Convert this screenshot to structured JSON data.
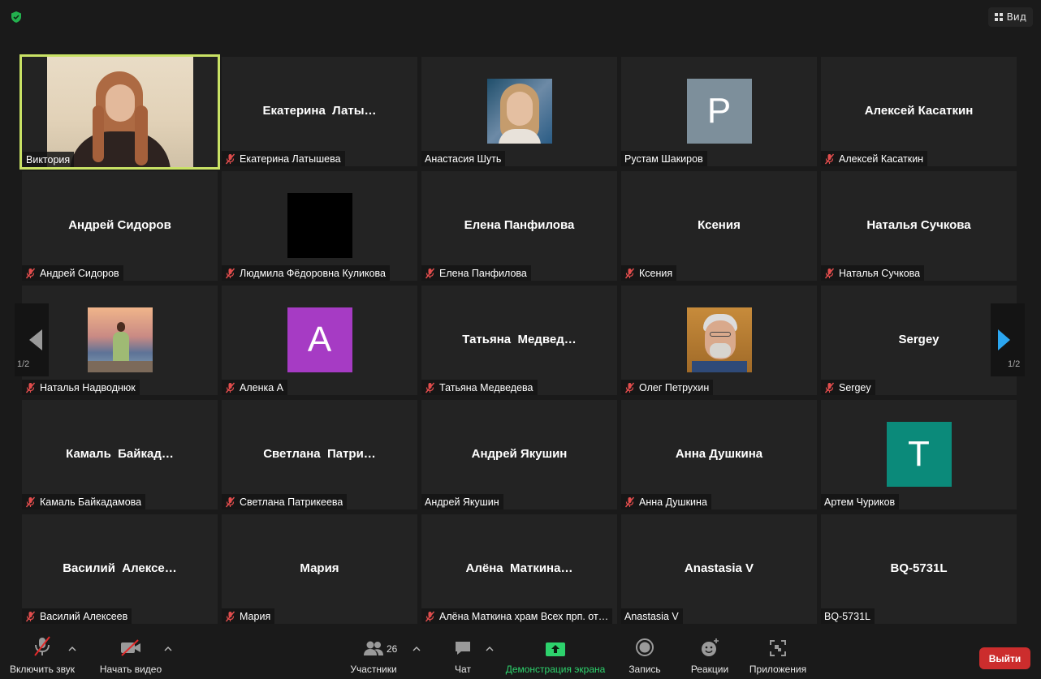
{
  "top_bar": {
    "view_label": "Вид"
  },
  "pagination": {
    "left": "1/2",
    "right": "1/2"
  },
  "tiles": [
    {
      "label": "Виктория",
      "center": "",
      "avatar": "video",
      "muted": false
    },
    {
      "label": "Екатерина Латышева",
      "center": "Екатерина  Латы…",
      "avatar": "",
      "muted": true
    },
    {
      "label": "Анастасия Шуть",
      "center": "",
      "avatar": "photo",
      "muted": false
    },
    {
      "label": "Рустам Шакиров",
      "center": "",
      "avatar": "letter",
      "letter": "P",
      "avatar_color": "#7d8f9b",
      "muted": false
    },
    {
      "label": "Алексей Касаткин",
      "center": "Алексей Касаткин",
      "avatar": "",
      "muted": true
    },
    {
      "label": "Андрей Сидоров",
      "center": "Андрей Сидоров",
      "avatar": "",
      "muted": true
    },
    {
      "label": "Людмила Фёдоровна Куликова",
      "center": "",
      "avatar": "black",
      "muted": true
    },
    {
      "label": "Елена Панфилова",
      "center": "Елена Панфилова",
      "avatar": "",
      "muted": true
    },
    {
      "label": "Ксения",
      "center": "Ксения",
      "avatar": "",
      "muted": true
    },
    {
      "label": "Наталья Сучкова",
      "center": "Наталья Сучкова",
      "avatar": "",
      "muted": true
    },
    {
      "label": "Наталья Надводнюк",
      "center": "",
      "avatar": "photo-sunset",
      "muted": true
    },
    {
      "label": "Аленка А",
      "center": "",
      "avatar": "letter",
      "letter": "A",
      "avatar_color": "#a63bc4",
      "muted": true
    },
    {
      "label": "Татьяна Медведева",
      "center": "Татьяна  Медвед…",
      "avatar": "",
      "muted": true
    },
    {
      "label": "Олег Петрухин",
      "center": "",
      "avatar": "photo-man",
      "muted": true
    },
    {
      "label": "Sergey",
      "center": "Sergey",
      "avatar": "",
      "muted": true
    },
    {
      "label": "Камаль Байкадамова",
      "center": "Камаль  Байкад…",
      "avatar": "",
      "muted": true
    },
    {
      "label": "Светлана Патрикеева",
      "center": "Светлана  Патри…",
      "avatar": "",
      "muted": true
    },
    {
      "label": "Андрей Якушин",
      "center": "Андрей Якушин",
      "avatar": "",
      "muted": false
    },
    {
      "label": "Анна Душкина",
      "center": "Анна Душкина",
      "avatar": "",
      "muted": true
    },
    {
      "label": "Артем Чуриков",
      "center": "",
      "avatar": "letter",
      "letter": "T",
      "avatar_color": "#0b8a7a",
      "muted": false
    },
    {
      "label": "Василий Алексеев",
      "center": "Василий  Алексе…",
      "avatar": "",
      "muted": true
    },
    {
      "label": "Мария",
      "center": "Мария",
      "avatar": "",
      "muted": true
    },
    {
      "label": "Алёна Маткина храм Всех прп. от…",
      "center": "Алёна  Маткина…",
      "avatar": "",
      "muted": true
    },
    {
      "label": "Anastasia V",
      "center": "Anastasia V",
      "avatar": "",
      "muted": false
    },
    {
      "label": "BQ-5731L",
      "center": "BQ-5731L",
      "avatar": "",
      "muted": false
    }
  ],
  "toolbar": {
    "unmute_label": "Включить звук",
    "start_video_label": "Начать видео",
    "participants_label": "Участники",
    "participants_count": "26",
    "chat_label": "Чат",
    "share_label": "Демонстрация экрана",
    "record_label": "Запись",
    "reactions_label": "Реакции",
    "apps_label": "Приложения",
    "leave_label": "Выйти"
  },
  "colors": {
    "active_speaker_border": "#c9e265",
    "share_green": "#2dd26c",
    "leave_red": "#cc2d2d"
  }
}
